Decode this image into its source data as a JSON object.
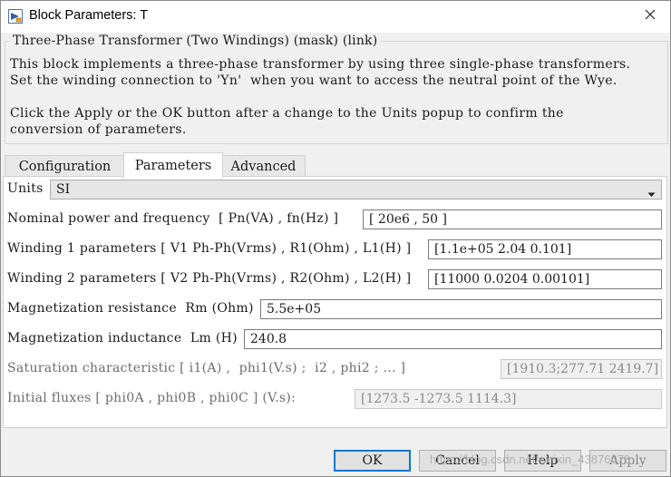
{
  "window": {
    "title": "Block Parameters: T"
  },
  "mask": {
    "title": "Three-Phase Transformer (Two Windings) (mask) (link)",
    "description": [
      "This block implements a three-phase transformer by using three single-phase transformers.",
      "Set the winding connection to 'Yn'  when you want to access the neutral point of the Wye.",
      "Click the Apply or the OK button after a change to the Units popup to confirm the",
      "conversion of parameters."
    ]
  },
  "tabs": [
    "Configuration",
    "Parameters",
    "Advanced"
  ],
  "active_tab": "Parameters",
  "units": {
    "label": "Units",
    "value": "SI"
  },
  "params": [
    {
      "label": "Nominal power and frequency  [ Pn(VA) , fn(Hz) ]",
      "value": "[ 20e6 , 50 ]"
    },
    {
      "label": "Winding 1 parameters [ V1 Ph-Ph(Vrms) , R1(Ohm) , L1(H) ]",
      "value": "[1.1e+05 2.04 0.101]"
    },
    {
      "label": "Winding 2 parameters [ V2 Ph-Ph(Vrms) , R2(Ohm) , L2(H) ]",
      "value": "[11000 0.0204 0.00101]"
    },
    {
      "label": "Magnetization resistance  Rm (Ohm)",
      "value": "5.5e+05"
    },
    {
      "label": "Magnetization inductance  Lm (H)",
      "value": "240.8"
    },
    {
      "label": "Saturation characteristic [ i1(A) ,  phi1(V.s) ;  i2 , phi2 ; ... ]",
      "value": "[1910.3;277.71 2419.7]"
    },
    {
      "label": "Initial fluxes [ phi0A , phi0B , phi0C ] (V.s):",
      "value": "[1273.5 -1273.5 1114.3]"
    }
  ],
  "buttons": {
    "ok": "OK",
    "cancel": "Cancel",
    "help": "Help",
    "apply": "Apply"
  },
  "watermark": "https://blog.csdn.net/weixin_43876078"
}
